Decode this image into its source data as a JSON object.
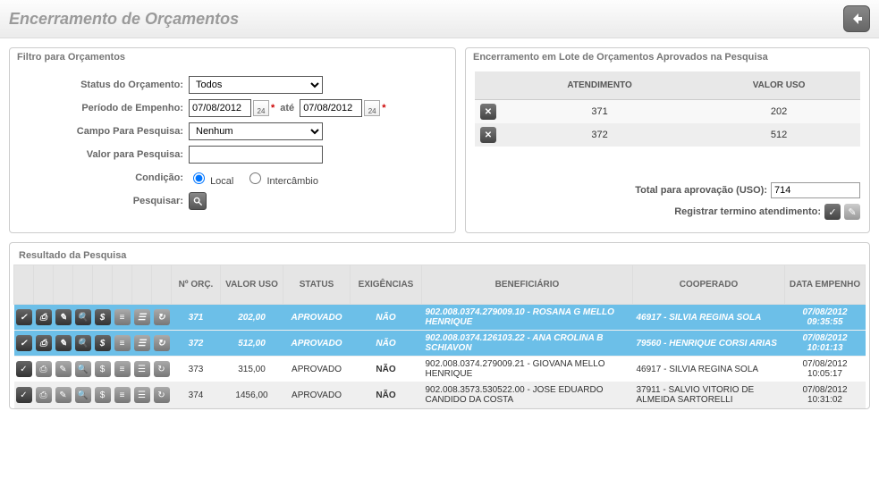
{
  "page": {
    "title": "Encerramento de Orçamentos"
  },
  "filter": {
    "panel_title": "Filtro para Orçamentos",
    "labels": {
      "status": "Status do Orçamento:",
      "periodo": "Período de Empenho:",
      "ate": "até",
      "campo": "Campo Para Pesquisa:",
      "valor": "Valor para Pesquisa:",
      "condicao": "Condição:",
      "pesquisar": "Pesquisar:"
    },
    "status_value": "Todos",
    "date_from": "07/08/2012",
    "date_to": "07/08/2012",
    "campo_value": "Nenhum",
    "valor_value": "",
    "radios": {
      "local": "Local",
      "intercambio": "Intercâmbio"
    }
  },
  "approve": {
    "panel_title": "Encerramento em Lote de Orçamentos Aprovados na Pesquisa",
    "headers": {
      "atendimento": "ATENDIMENTO",
      "valor_uso": "VALOR USO"
    },
    "rows": [
      {
        "atendimento": "371",
        "valor": "202"
      },
      {
        "atendimento": "372",
        "valor": "512"
      }
    ],
    "total_label": "Total para aprovação (USO):",
    "total_value": "714",
    "registrar_label": "Registrar termino atendimento:"
  },
  "results": {
    "panel_title": "Resultado da Pesquisa",
    "headers": {
      "n_orc": "Nº ORÇ.",
      "valor_uso": "VALOR USO",
      "status": "STATUS",
      "exigencias": "EXIGÊNCIAS",
      "beneficiario": "BENEFICIÁRIO",
      "cooperado": "COOPERADO",
      "data_empenho": "DATA EMPENHO"
    },
    "rows": [
      {
        "selected": true,
        "n": "371",
        "valor": "202,00",
        "status": "APROVADO",
        "exig": "NÃO",
        "benef": "902.008.0374.279009.10 - ROSANA G MELLO HENRIQUE",
        "coop": "46917 - SILVIA REGINA SOLA",
        "data": "07/08/2012 09:35:55"
      },
      {
        "selected": true,
        "n": "372",
        "valor": "512,00",
        "status": "APROVADO",
        "exig": "NÃO",
        "benef": "902.008.0374.126103.22 - ANA CROLINA B SCHIAVON",
        "coop": "79560 - HENRIQUE CORSI ARIAS",
        "data": "07/08/2012 10:01:13"
      },
      {
        "selected": false,
        "n": "373",
        "valor": "315,00",
        "status": "APROVADO",
        "exig": "NÃO",
        "benef": "902.008.0374.279009.21 - GIOVANA MELLO HENRIQUE",
        "coop": "46917 - SILVIA REGINA SOLA",
        "data": "07/08/2012 10:05:17"
      },
      {
        "selected": false,
        "n": "374",
        "valor": "1456,00",
        "status": "APROVADO",
        "exig": "NÃO",
        "benef": "902.008.3573.530522.00 - JOSE EDUARDO CANDIDO DA COSTA",
        "coop": "37911 - SALVIO VITORIO DE ALMEIDA SARTORELLI",
        "data": "07/08/2012 10:31:02"
      }
    ]
  }
}
